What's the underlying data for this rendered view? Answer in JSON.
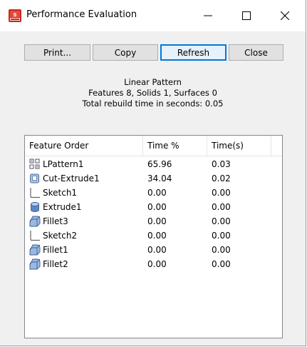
{
  "window": {
    "title": "Performance Evaluation",
    "controls": {
      "minimize": "—",
      "maximize": "☐",
      "close": "✕"
    }
  },
  "buttons": {
    "print": "Print...",
    "copy": "Copy",
    "refresh": "Refresh",
    "close": "Close"
  },
  "summary": {
    "line1": "Linear Pattern",
    "line2": "Features 8, Solids 1, Surfaces 0",
    "line3": "Total rebuild time in seconds: 0.05"
  },
  "table": {
    "columns": [
      "Feature Order",
      "Time %",
      "Time(s)"
    ],
    "rows": [
      {
        "icon": "linear-pattern-icon",
        "name": "LPattern1",
        "percent": "65.96",
        "time": "0.03"
      },
      {
        "icon": "cut-extrude-icon",
        "name": "Cut-Extrude1",
        "percent": "34.04",
        "time": "0.02"
      },
      {
        "icon": "sketch-icon",
        "name": "Sketch1",
        "percent": "0.00",
        "time": "0.00"
      },
      {
        "icon": "extrude-icon",
        "name": "Extrude1",
        "percent": "0.00",
        "time": "0.00"
      },
      {
        "icon": "fillet-icon",
        "name": "Fillet3",
        "percent": "0.00",
        "time": "0.00"
      },
      {
        "icon": "sketch-icon",
        "name": "Sketch2",
        "percent": "0.00",
        "time": "0.00"
      },
      {
        "icon": "fillet-icon",
        "name": "Fillet1",
        "percent": "0.00",
        "time": "0.00"
      },
      {
        "icon": "fillet-icon",
        "name": "Fillet2",
        "percent": "0.00",
        "time": "0.00"
      }
    ]
  },
  "colors": {
    "accent": "#0078d7",
    "window_bg": "#f0f0f0",
    "list_bg": "#ffffff"
  }
}
